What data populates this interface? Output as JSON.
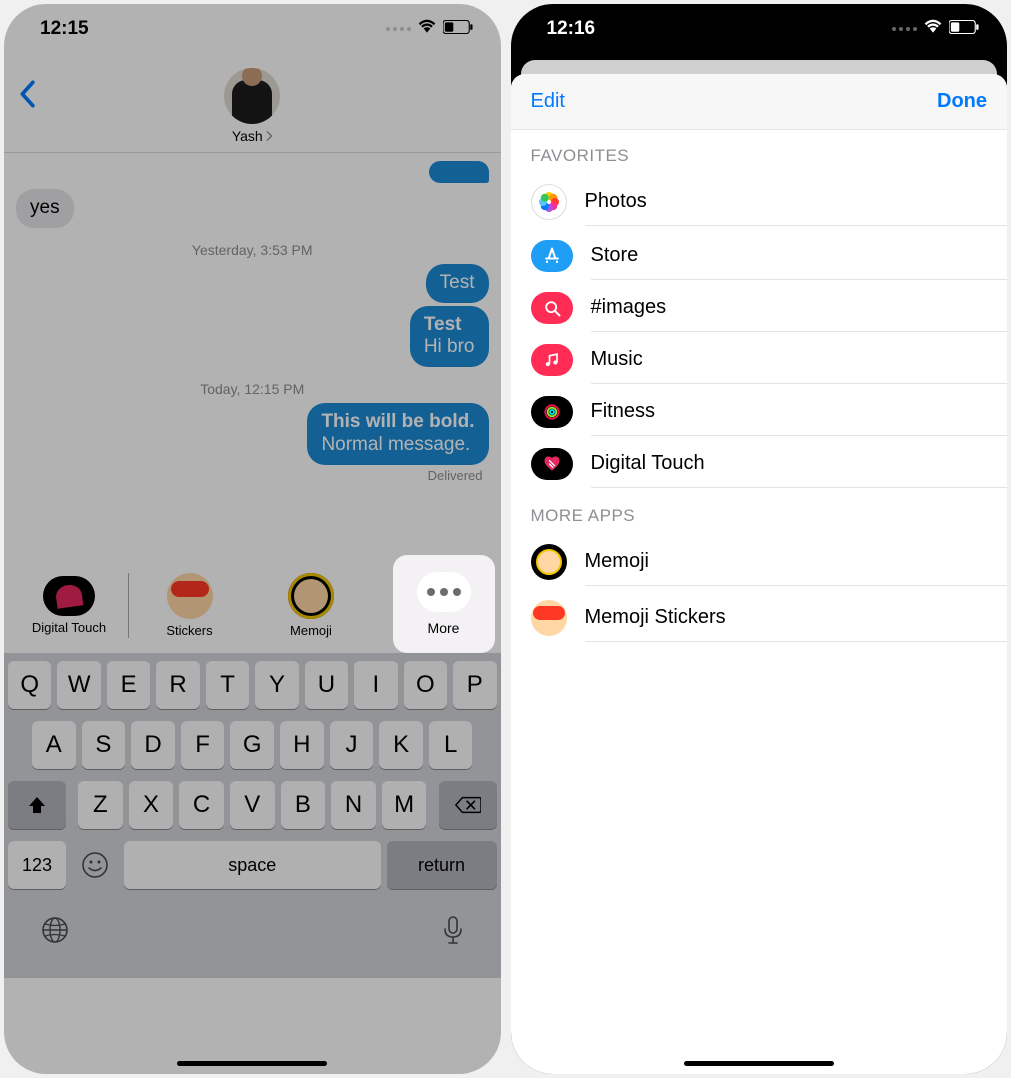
{
  "left": {
    "status": {
      "time": "12:15"
    },
    "contact": {
      "name": "Yash"
    },
    "thread": {
      "m1": "yes",
      "ts1": "Yesterday, 3:53 PM",
      "m2": "Test",
      "m3a": "Test",
      "m3b": "Hi bro",
      "ts2": "Today, 12:15 PM",
      "m4a": "This will be bold.",
      "m4b": "Normal message.",
      "delivered": "Delivered"
    },
    "apps": {
      "digital": "Digital Touch",
      "stickers": "Stickers",
      "memoji": "Memoji",
      "more": "More"
    },
    "keyboard": {
      "row1": [
        "Q",
        "W",
        "E",
        "R",
        "T",
        "Y",
        "U",
        "I",
        "O",
        "P"
      ],
      "row2": [
        "A",
        "S",
        "D",
        "F",
        "G",
        "H",
        "J",
        "K",
        "L"
      ],
      "row3": [
        "Z",
        "X",
        "C",
        "V",
        "B",
        "N",
        "M"
      ],
      "num": "123",
      "space": "space",
      "return": "return"
    }
  },
  "right": {
    "status": {
      "time": "12:16"
    },
    "sheet": {
      "edit": "Edit",
      "done": "Done",
      "sections": {
        "favorites_title": "FAVORITES",
        "more_title": "MORE APPS"
      },
      "favorites": {
        "photos": "Photos",
        "store": "Store",
        "images": "#images",
        "music": "Music",
        "fitness": "Fitness",
        "digital": "Digital Touch"
      },
      "more_apps": {
        "memoji": "Memoji",
        "memoji_stickers": "Memoji Stickers"
      }
    }
  }
}
